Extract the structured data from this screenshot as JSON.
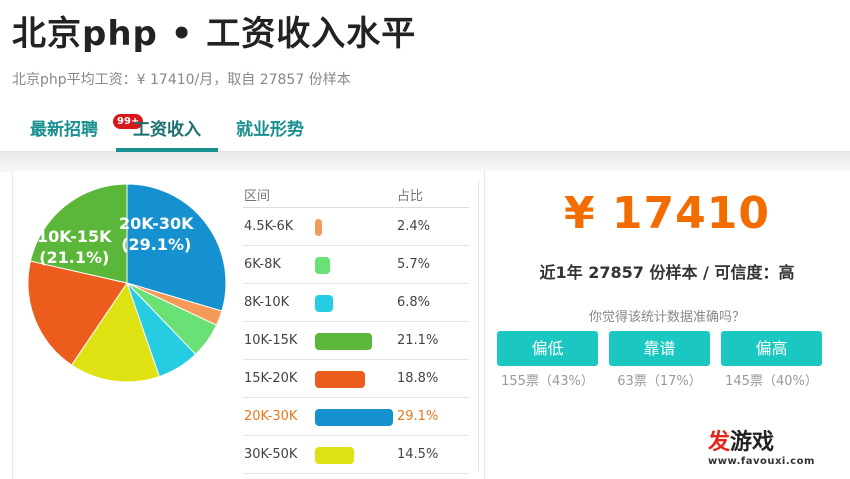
{
  "header": {
    "title": "北京php • 工资收入水平",
    "subtitle": "北京php平均工资：¥ 17410/月，取自 27857 份样本"
  },
  "tabs": [
    {
      "label": "最新招聘",
      "badge": "99+"
    },
    {
      "label": "工资收入",
      "active": true
    },
    {
      "label": "就业形势"
    }
  ],
  "table": {
    "header_range": "区间",
    "header_pct": "占比"
  },
  "chart_data": {
    "type": "pie",
    "categories": [
      "4.5K-6K",
      "6K-8K",
      "8K-10K",
      "10K-15K",
      "15K-20K",
      "20K-30K",
      "30K-50K"
    ],
    "values": [
      2.4,
      5.7,
      6.8,
      21.1,
      18.8,
      29.1,
      14.5
    ],
    "labels": [
      "2.4%",
      "5.7%",
      "6.8%",
      "21.1%",
      "18.8%",
      "29.1%",
      "14.5%"
    ],
    "colors": [
      "#f69a5a",
      "#69e174",
      "#26cde2",
      "#5bb73a",
      "#ec5c1d",
      "#1691cf",
      "#dee213"
    ],
    "slice_label_big": {
      "range": "20K-30K",
      "pct": "(29.1%)"
    },
    "slice_label_second": {
      "range": "10K-15K",
      "pct": "(21.1%)"
    },
    "highlighted": "20K-30K"
  },
  "summary": {
    "amount": "¥ 17410",
    "meta": "近1年 27857 份样本 / 可信度：高",
    "question": "你觉得该统计数据准确吗？"
  },
  "votes": [
    {
      "label": "偏低",
      "count": "155票（43%）"
    },
    {
      "label": "靠谱",
      "count": "63票（17%）"
    },
    {
      "label": "偏高",
      "count": "145票（40%）"
    }
  ],
  "watermark": {
    "text_a": "发",
    "text_b": "游戏",
    "url": "www.favouxi.com"
  }
}
